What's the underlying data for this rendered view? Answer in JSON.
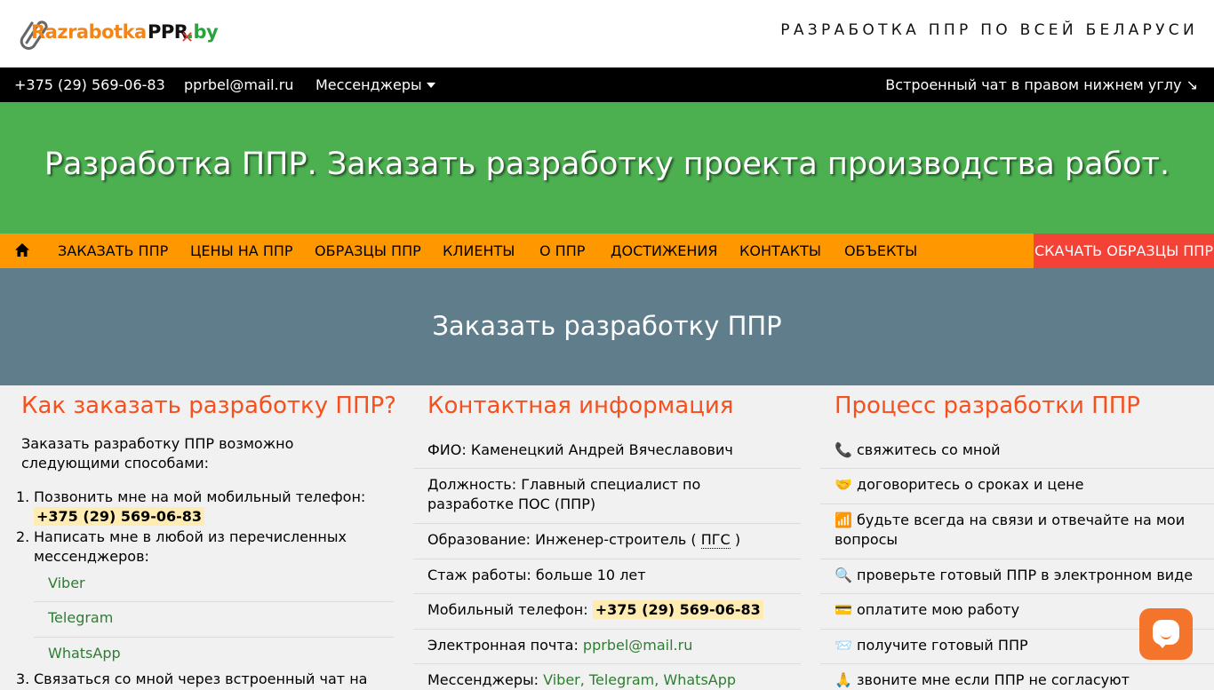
{
  "header": {
    "logo": {
      "part1": "Razrabotka",
      "part2": "PPR",
      "part3": ".by"
    },
    "tagline": "РАЗРАБОТКА ППР ПО ВСЕЙ БЕЛАРУСИ"
  },
  "topbar": {
    "phone": "+375 (29) 569-06-83",
    "email": "pprbel@mail.ru",
    "messengers": "Мессенджеры",
    "chat_note": "Встроенный чат в правом нижнем углу ↘"
  },
  "hero": {
    "title": "Разработка ППР. Заказать разработку проекта производства работ."
  },
  "nav": {
    "home_icon": "home-icon",
    "items": [
      "ЗАКАЗАТЬ ППР",
      "ЦЕНЫ НА ППР",
      "ОБРАЗЦЫ ППР",
      "КЛИЕНТЫ",
      "О ППР",
      "ДОСТИЖЕНИЯ",
      "КОНТАКТЫ",
      "ОБЪЕКТЫ"
    ],
    "download": "СКАЧАТЬ ОБРАЗЦЫ ППР"
  },
  "banner": {
    "title": "Заказать разработку ППР"
  },
  "how": {
    "title": "Как заказать разработку ППР?",
    "intro": "Заказать разработку ППР возможно следующими способами:",
    "step1": "Позвонить мне на мой мобильный телефон:",
    "step1_phone": "+375 (29) 569-06-83",
    "step2": "Написать мне в любой из перечисленных мессенджеров:",
    "messengers": [
      "Viber",
      "Telegram",
      "WhatsApp"
    ],
    "step3": "Связаться со мной через встроенный чат на"
  },
  "contact": {
    "title": "Контактная информация",
    "name_label": "ФИО:",
    "name": "Каменецкий Андрей Вячеславович",
    "position_label": "Должность:",
    "position": "Главный специалист по разработке ПОС (ППР)",
    "education_label": "Образование:",
    "education": "Инженер-строитель (",
    "education_abbr": "ПГС",
    "education_end": ")",
    "experience_label": "Стаж работы:",
    "experience": "больше 10 лет",
    "mobile_label": "Мобильный телефон:",
    "mobile": "+375 (29) 569-06-83",
    "email_label": "Электронная почта:",
    "email": "pprbel@mail.ru",
    "messengers_label": "Мессенджеры:",
    "messengers": "Viber, Telegram, WhatsApp"
  },
  "process": {
    "title": "Процесс разработки ППР",
    "steps": [
      "📞 свяжитесь со мной",
      "🤝 договоритесь о сроках и цене",
      "📶 будьте всегда на связи и отвечайте на мои вопросы",
      "🔍 проверьте готовый ППР в электронном виде",
      "💳 оплатите мою работу",
      "📨 получите готовый ППР",
      "🙏 звоните мне если ППР не согласуют"
    ]
  },
  "colors": {
    "green": "#4caf50",
    "orange": "#ff9800",
    "red": "#f44336",
    "slate": "#607d8b",
    "heading": "#f4511e",
    "chat": "#f4742c"
  }
}
